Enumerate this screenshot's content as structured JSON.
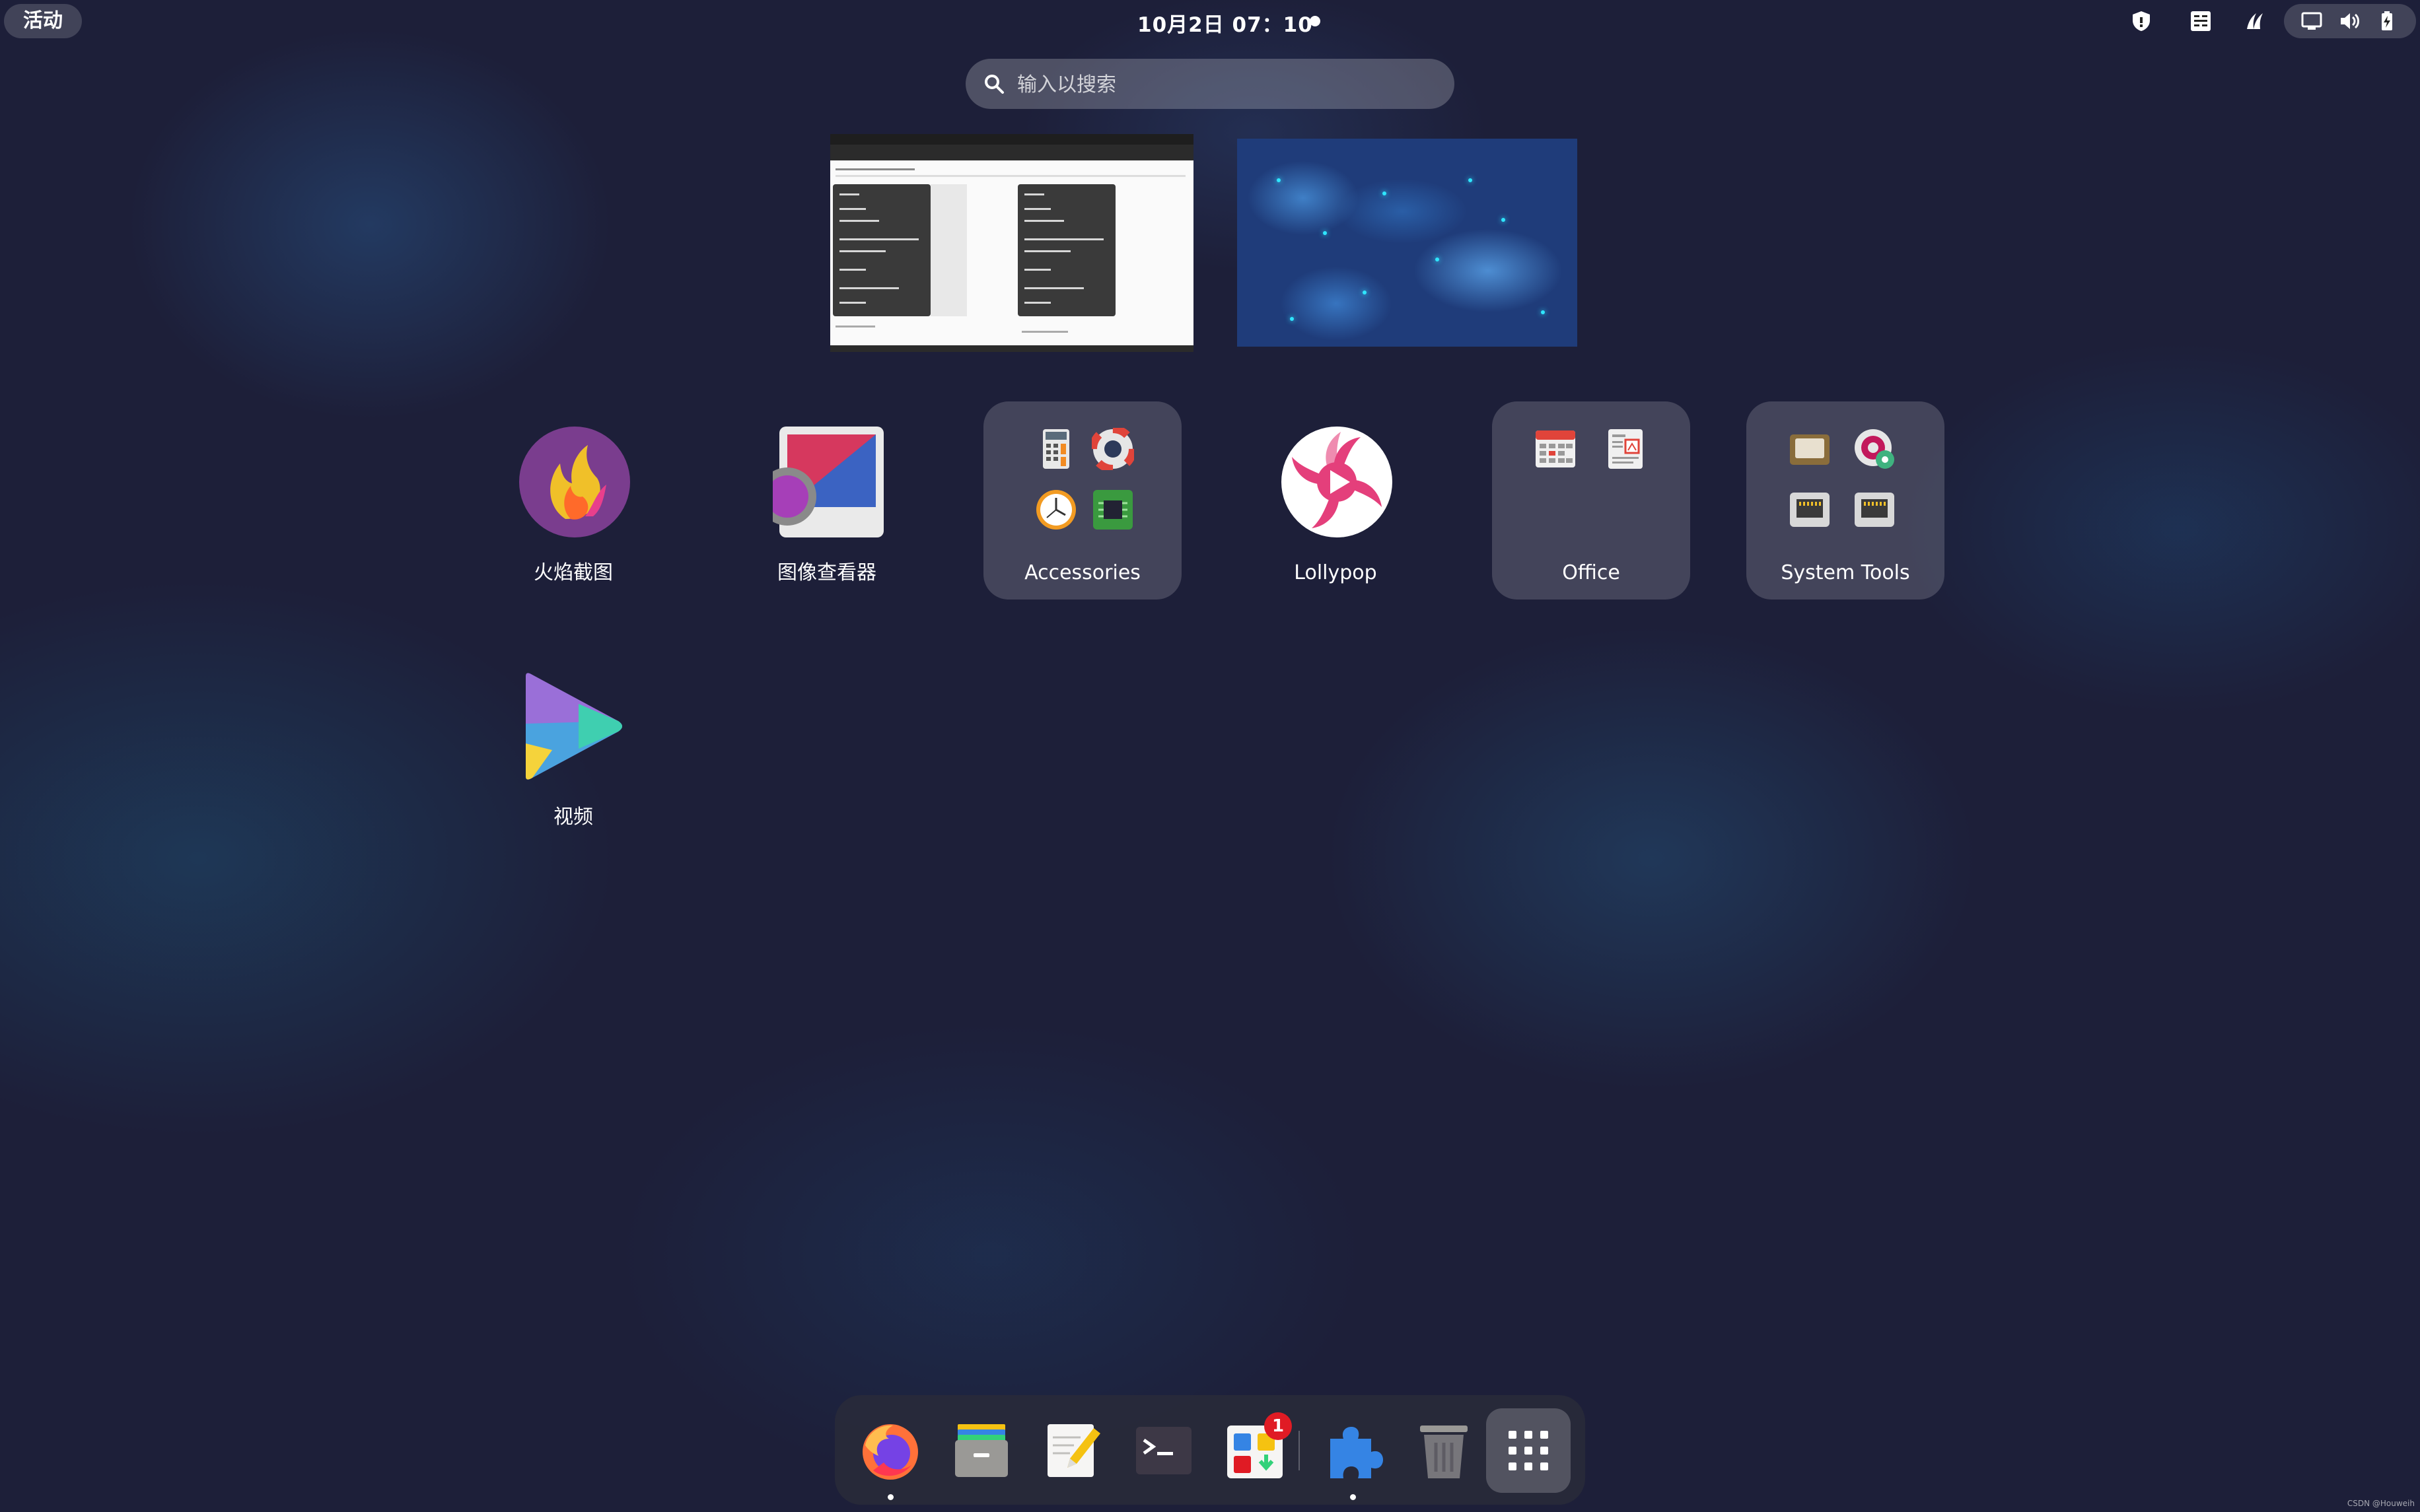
{
  "topbar": {
    "activities_label": "活动",
    "clock": "10月2日  07：10",
    "tray_icons": [
      "shield-icon",
      "keyboard-layout-icon",
      "fcitx-icon",
      "network-wired-icon",
      "volume-icon",
      "battery-icon"
    ]
  },
  "search": {
    "placeholder": "输入以搜索"
  },
  "workspaces": [
    {
      "name": "workspace-1",
      "content": "document-window"
    },
    {
      "name": "workspace-2",
      "content": "empty-wallpaper"
    }
  ],
  "apps": [
    {
      "label": "火焰截图",
      "icon": "flameshot-icon"
    },
    {
      "label": "图像查看器",
      "icon": "image-viewer-icon"
    },
    {
      "label": "Accessories",
      "icon": "folder-icon",
      "folder_icons": [
        "calculator-icon",
        "help-icon",
        "clock-icon",
        "system-monitor-icon"
      ]
    },
    {
      "label": "Lollypop",
      "icon": "lollypop-icon"
    },
    {
      "label": "Office",
      "icon": "folder-icon",
      "folder_icons": [
        "calendar-icon",
        "document-viewer-icon"
      ]
    },
    {
      "label": "System Tools",
      "icon": "folder-icon",
      "folder_icons": [
        "disk-icon",
        "disk-usage-icon",
        "network-icon",
        "network-icon"
      ]
    },
    {
      "label": "视频",
      "icon": "videos-icon"
    }
  ],
  "dock": {
    "items": [
      "firefox-icon",
      "files-icon",
      "text-editor-icon",
      "terminal-icon",
      "software-icon",
      "extensions-icon",
      "trash-icon",
      "show-apps-icon"
    ],
    "software_badge": "1"
  },
  "watermark": "CSDN @Houweih",
  "colors": {
    "badge": "#e01b24",
    "accent": "#3584e4"
  }
}
